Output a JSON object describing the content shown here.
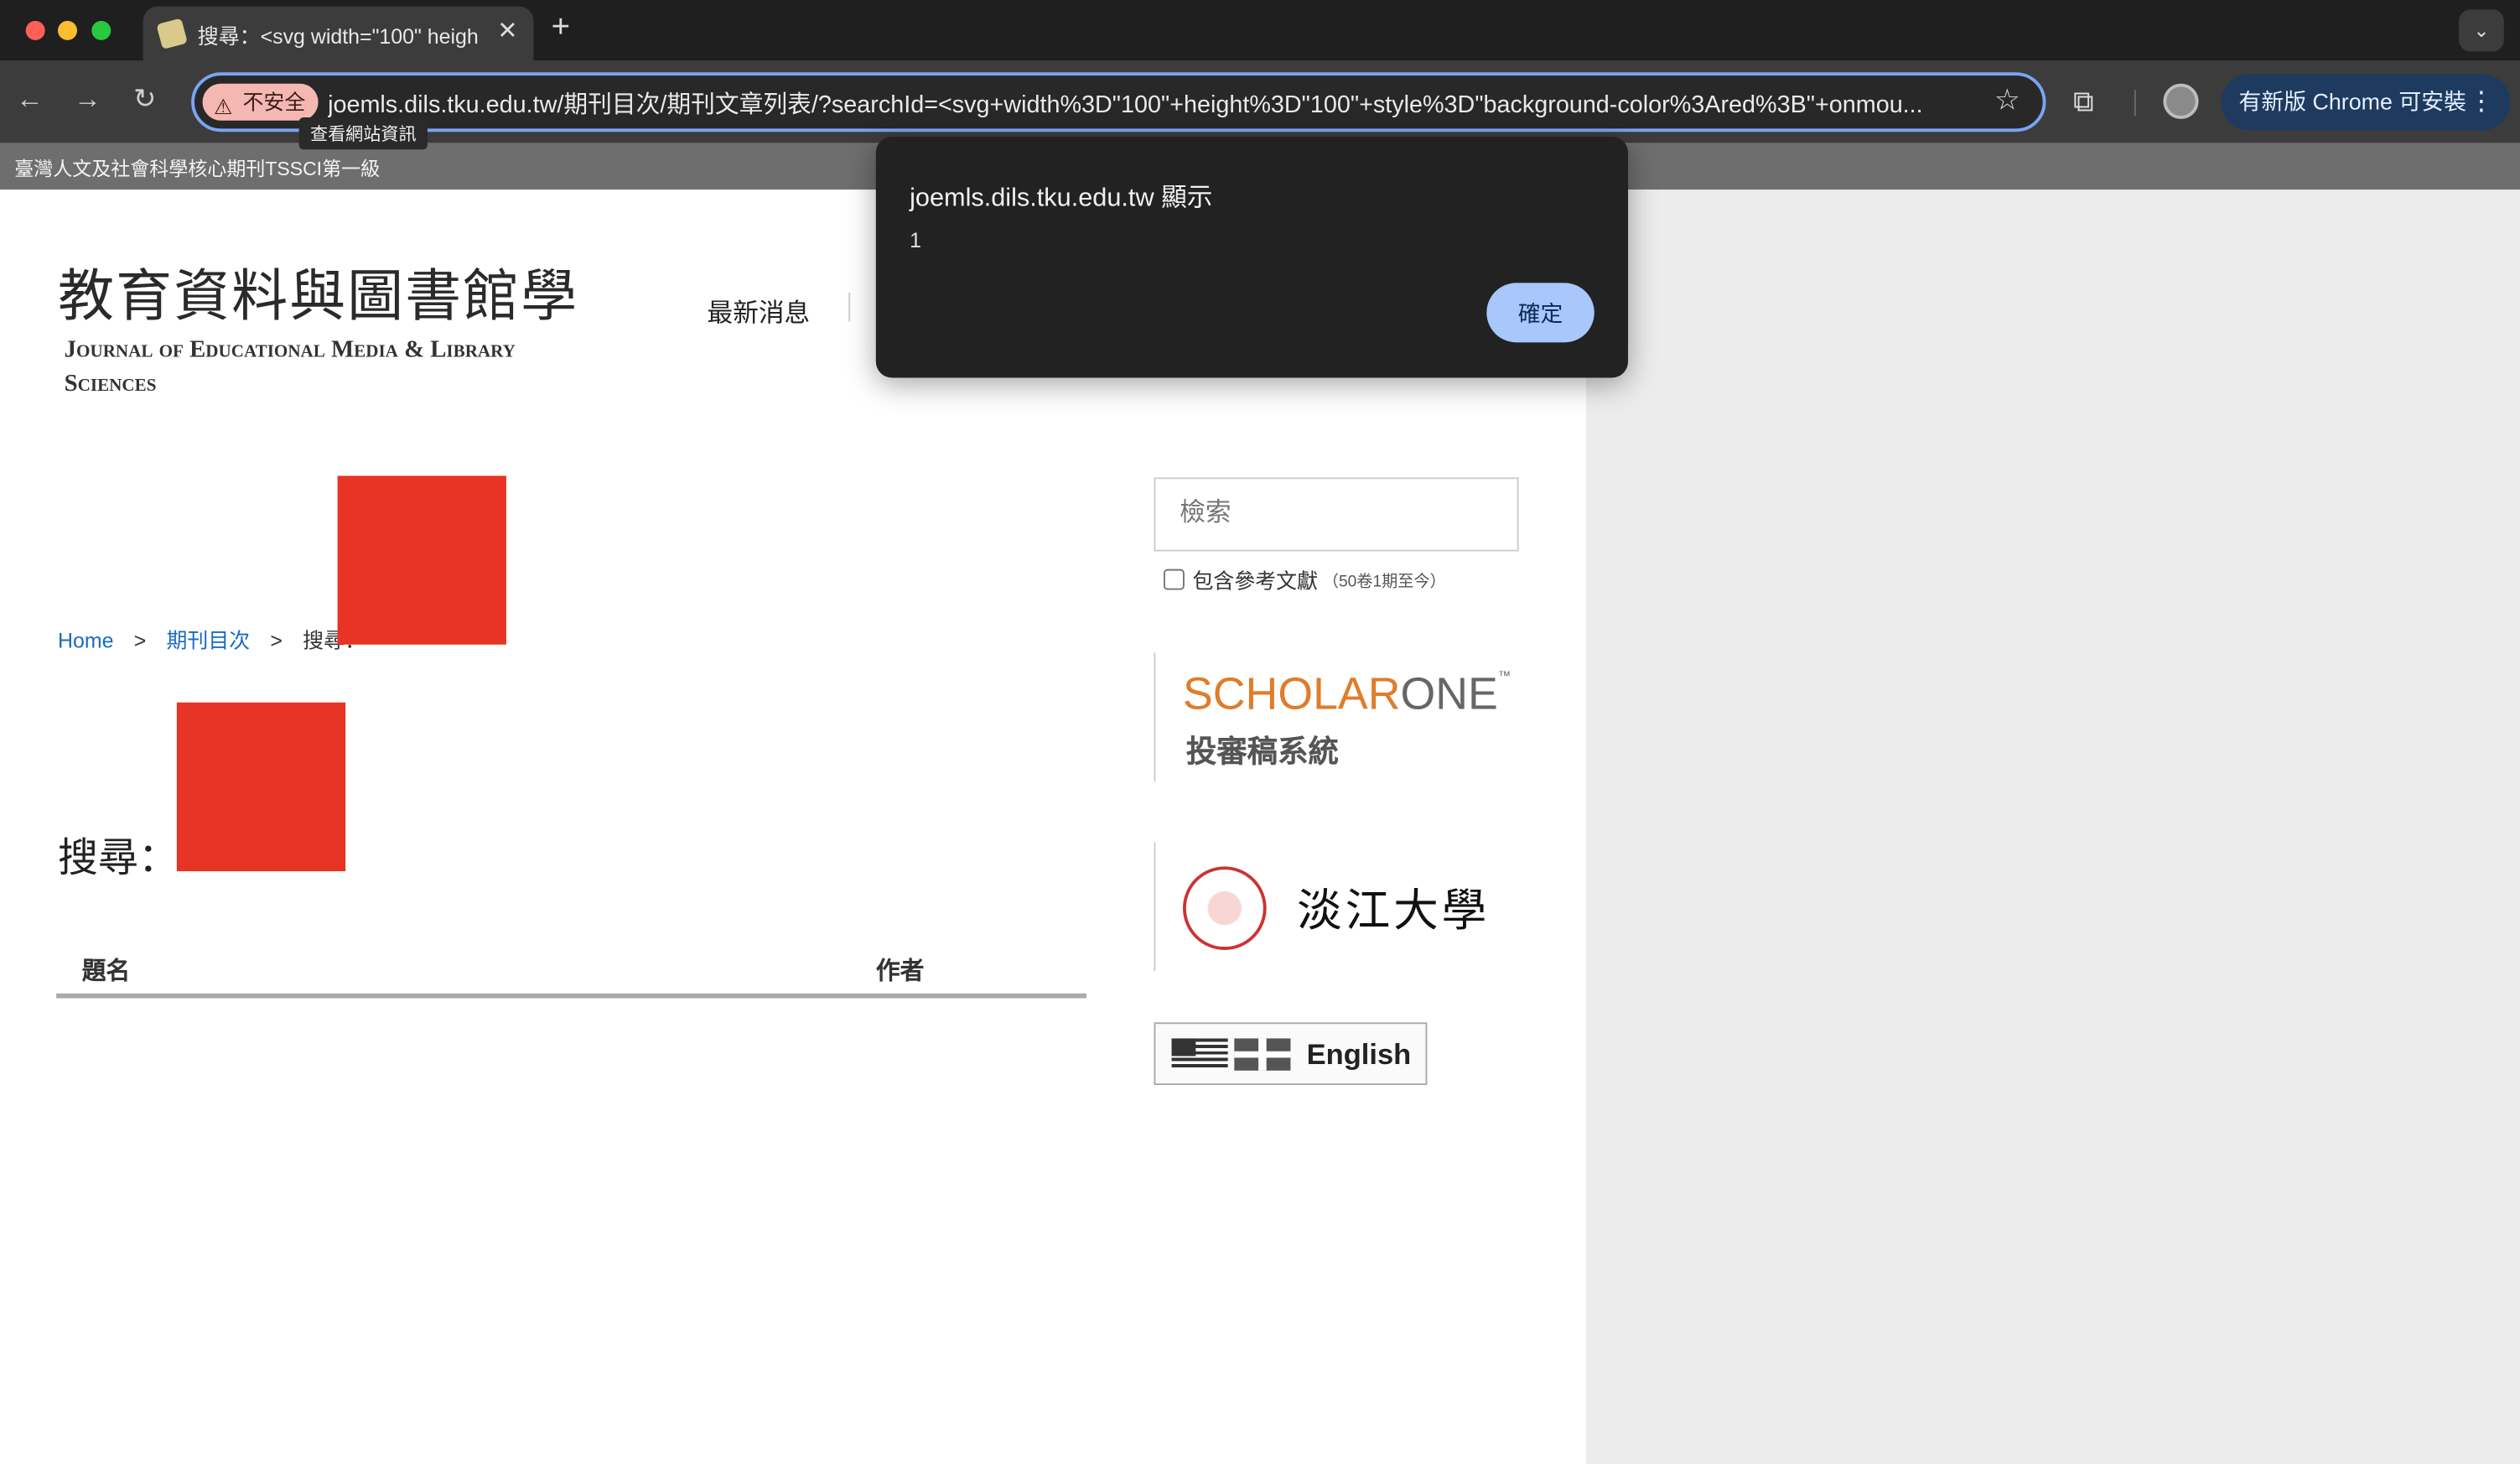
{
  "browser": {
    "tab_title": "搜尋：<svg width=\"100\" heigh",
    "tab_close": "✕",
    "new_tab": "+",
    "tab_search": "⌄",
    "nav_back": "←",
    "nav_forward": "→",
    "nav_reload": "↻",
    "insecure_label": "不安全",
    "insecure_icon": "⚠",
    "url": "joemls.dils.tku.edu.tw/期刊目次/期刊文章列表/?searchId=<svg+width%3D\"100\"+height%3D\"100\"+style%3D\"background-color%3Ared%3B\"+onmou...",
    "tooltip": "查看網站資訊",
    "star": "☆",
    "extension_icon": "⧉",
    "update_label": "有新版 Chrome 可安裝",
    "update_menu": "⋮"
  },
  "bookmarks": {
    "text": "臺灣人文及社會科學核心期刊TSSCI第一級"
  },
  "header": {
    "logo_cn": "教育資料與圖書館學",
    "logo_en": "Journal of Educational Media & Library Sciences",
    "nav_news": "最新消息"
  },
  "breadcrumb": {
    "home": "Home",
    "sep1": ">",
    "issues": "期刊目次",
    "sep2": ">",
    "search": "搜尋："
  },
  "main": {
    "search_heading": "搜尋：",
    "table_headers": [
      "題名",
      "作者"
    ]
  },
  "sidebar": {
    "search_placeholder": "檢索",
    "ref_checkbox_label": "包含參考文獻",
    "ref_checkbox_note": "（50卷1期至今）",
    "scholar_part1": "SCHOLAR",
    "scholar_part2": "ONE",
    "scholar_tm": "™",
    "scholar_cn": "投審稿系統",
    "tku_cn": "淡江大學",
    "english_label": "English"
  },
  "dialog": {
    "title": "joemls.dils.tku.edu.tw 顯示",
    "message": "1",
    "ok_label": "確定"
  },
  "colors": {
    "injected_box": "#e83425",
    "dialog_button": "#a8c7fa",
    "link": "#1a6bbf"
  }
}
